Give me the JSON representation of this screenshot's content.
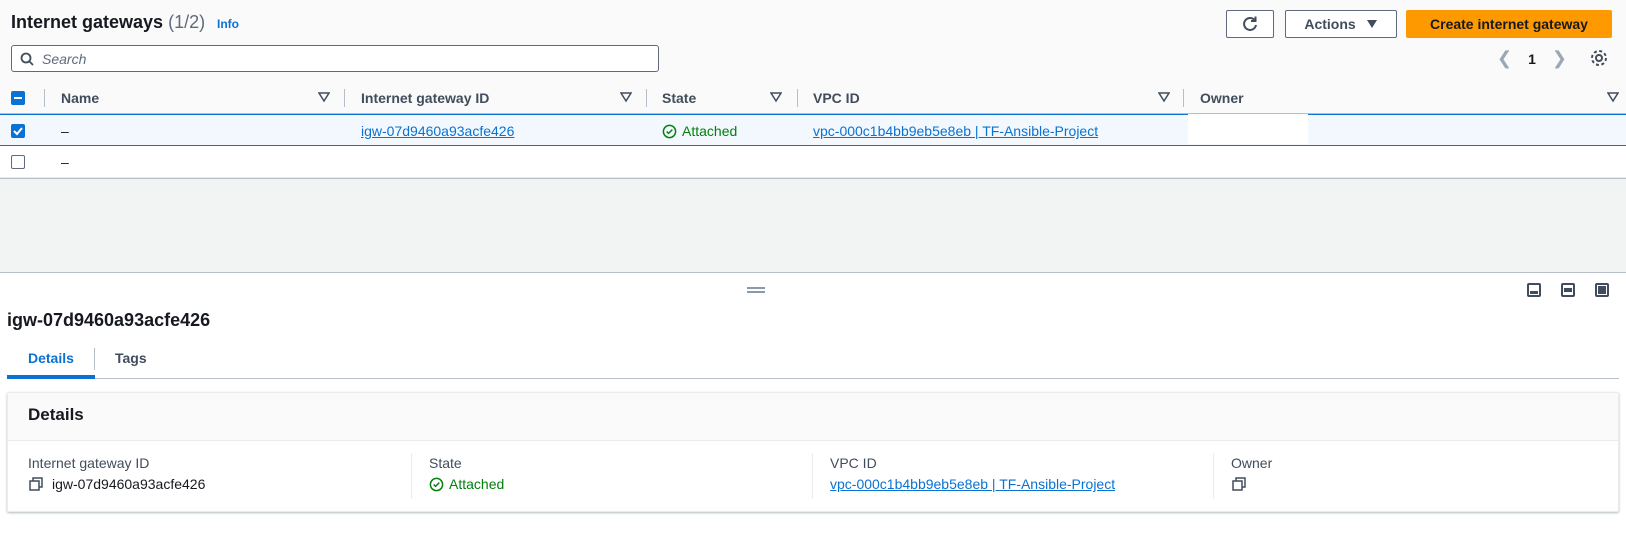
{
  "header": {
    "title": "Internet gateways",
    "count": "(1/2)",
    "info": "Info",
    "actions_label": "Actions",
    "create_label": "Create internet gateway"
  },
  "search": {
    "placeholder": "Search"
  },
  "pagination": {
    "current_page": "1"
  },
  "table": {
    "columns": [
      "Name",
      "Internet gateway ID",
      "State",
      "VPC ID",
      "Owner"
    ],
    "rows": [
      {
        "selected": true,
        "name": "–",
        "igw_id": "igw-07d9460a93acfe426",
        "state": "Attached",
        "vpc_id": "vpc-000c1b4bb9eb5e8eb | TF-Ansible-Project",
        "owner": ""
      },
      {
        "selected": false,
        "name": "–",
        "igw_id": "",
        "state": "",
        "vpc_id": "",
        "owner": ""
      }
    ]
  },
  "detail": {
    "title": "igw-07d9460a93acfe426",
    "tabs": [
      "Details",
      "Tags"
    ],
    "panel_title": "Details",
    "fields": [
      {
        "label": "Internet gateway ID",
        "value": "igw-07d9460a93acfe426"
      },
      {
        "label": "State",
        "value": "Attached"
      },
      {
        "label": "VPC ID",
        "value": "vpc-000c1b4bb9eb5e8eb | TF-Ansible-Project"
      },
      {
        "label": "Owner",
        "value": ""
      }
    ]
  },
  "colors": {
    "accent": "#0972d3",
    "primary_button": "#ff9900",
    "success": "#037f0c"
  }
}
